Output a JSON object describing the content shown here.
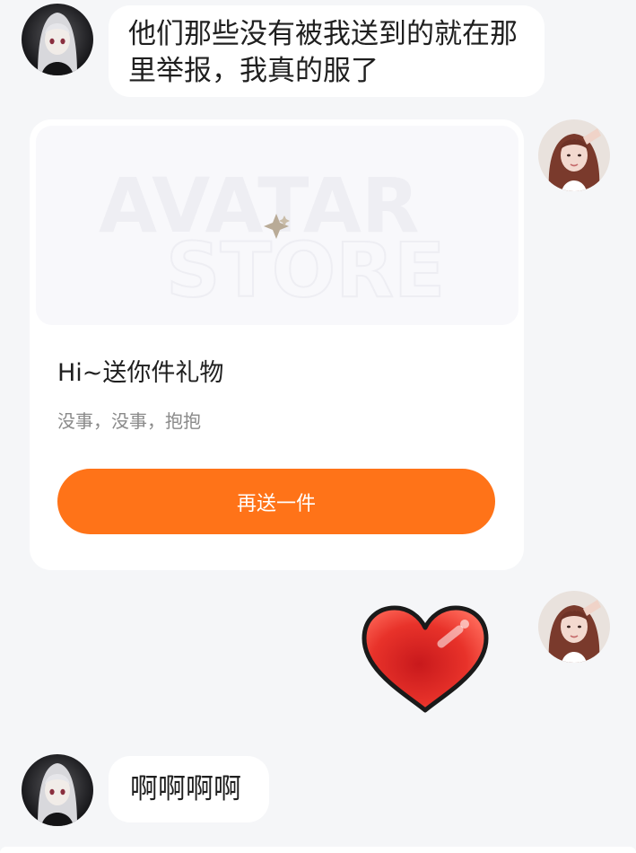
{
  "messages": [
    {
      "sender": "other",
      "avatar_icon": "anime-girl-avatar",
      "text": "他们那些没有被我送到的就在那里举报，我真的服了"
    },
    {
      "sender": "self",
      "avatar_icon": "girl-photo-avatar",
      "gift_card": {
        "image_watermark_line1": "AVATAR",
        "image_watermark_line2": "STORE",
        "title": "Hi~送你件礼物",
        "subtitle": "没事，没事，抱抱",
        "button_label": "再送一件"
      }
    },
    {
      "sender": "self",
      "avatar_icon": "girl-photo-avatar",
      "sticker_icon": "red-heart-icon"
    },
    {
      "sender": "other",
      "avatar_icon": "anime-girl-avatar",
      "text": "啊啊啊啊"
    }
  ],
  "colors": {
    "background": "#f5f6f8",
    "bubble": "#ffffff",
    "accent_button": "#ff7318",
    "heart": "#e8322a"
  }
}
